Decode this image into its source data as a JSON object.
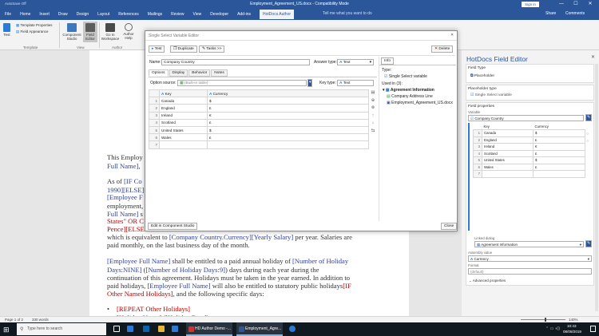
{
  "window": {
    "title": "Employment_Agreement_US.docx - Compatibility Mode",
    "autosave": "AutoSave  Off",
    "sign_in": "Sign in",
    "minimize": "—",
    "maximize": "☐",
    "close": "✕"
  },
  "ribbon": {
    "tabs": [
      "File",
      "Home",
      "Insert",
      "Draw",
      "Design",
      "Layout",
      "References",
      "Mailings",
      "Review",
      "View",
      "Developer",
      "Add-ins",
      "HotDocs Author"
    ],
    "active_tab": "HotDocs Author",
    "tell_me": "Tell me what you want to do",
    "share": "Share",
    "comments": "Comments",
    "test_label": "Test",
    "template_properties": "Template Properties",
    "field_appearance": "Field Appearance",
    "component_studio": "Component Studio",
    "field_editor": "Field Editor",
    "go_in_workspace": "Go In Workspace",
    "author_help": "Author Help",
    "group_template": "Template",
    "group_view": "View",
    "group_author": "Author"
  },
  "document": {
    "lines": [
      {
        "parts": [
          [
            "This Employ",
            "t"
          ]
        ]
      },
      {
        "parts": [
          [
            "Full Name]",
            "b"
          ],
          [
            ", ",
            "t"
          ]
        ]
      },
      {
        "parts": [
          [
            "As of ",
            "t"
          ],
          [
            "[IF Co",
            "b"
          ]
        ]
      },
      {
        "parts": [
          [
            "1990][ELSE]",
            "b"
          ]
        ]
      },
      {
        "parts": [
          [
            "[Employee F",
            "b"
          ]
        ]
      },
      {
        "parts": [
          [
            "employment,",
            "t"
          ]
        ]
      },
      {
        "parts": [
          [
            "Full Name]",
            "b"
          ],
          [
            " s",
            "t"
          ]
        ]
      },
      {
        "parts": [
          [
            "States\" OR C",
            "r"
          ]
        ]
      },
      {
        "parts": [
          [
            "Pence][ELSE",
            "r"
          ]
        ]
      },
      {
        "parts": [
          [
            "which is equivalent to ",
            "t"
          ],
          [
            "[Company Country.Currency][Yearly Salary]",
            "b"
          ],
          [
            " per year. Salaries are",
            "t"
          ]
        ]
      },
      {
        "parts": [
          [
            "paid monthly, on the last business day of the month.",
            "t"
          ]
        ]
      },
      {
        "parts": [
          [
            "[Employee Full Name]",
            "b"
          ],
          [
            " shall be entitled to a paid annual holiday of ",
            "t"
          ],
          [
            "[Number of Holiday",
            "b"
          ]
        ]
      },
      {
        "parts": [
          [
            "Days:NINE]",
            "b"
          ],
          [
            " (",
            "t"
          ],
          [
            "[Number of Holiday Days:9]",
            "b"
          ],
          [
            ") days during each year during the",
            "t"
          ]
        ]
      },
      {
        "parts": [
          [
            "continuation of this agreement. Holidays must be taken in the year earned. In addition to",
            "t"
          ]
        ]
      },
      {
        "parts": [
          [
            "paid holidays, ",
            "t"
          ],
          [
            "[Employee Full Name]",
            "b"
          ],
          [
            " will also be entitled to statutory public holidays",
            "t"
          ],
          [
            "[IF",
            "r"
          ]
        ]
      },
      {
        "parts": [
          [
            "Other Named Holidays]",
            "r"
          ],
          [
            ", and the following specific days:",
            "t"
          ]
        ]
      },
      {
        "parts": [
          [
            "[REPEAT Other Holidays]",
            "r"
          ]
        ]
      },
      {
        "parts": [
          [
            "[Holiday Name]",
            "b"
          ],
          [
            " (",
            "t"
          ],
          [
            "[Holiday Date]",
            "b"
          ],
          [
            ")",
            "t"
          ]
        ]
      }
    ],
    "bullet": "•"
  },
  "status": {
    "page": "Page 1 of 2",
    "words": "330 words",
    "zoom": "140%"
  },
  "taskbar": {
    "search": "Type here to search",
    "app1": "HD Author Demo -...",
    "app2": "Employment_Agre...",
    "time": "10:43",
    "date": "08/08/2019"
  },
  "dialog": {
    "title": "Single Select Variable Editor",
    "toolbar": {
      "test": "Test",
      "duplicate": "Duplicate",
      "tasks": "Tasks >>",
      "delete": "Delete"
    },
    "name_label": "Name:",
    "name_value": "Company Country",
    "answer_type_label": "Answer type:",
    "answer_type_value": "Text",
    "tabs": [
      "Options",
      "Display",
      "Behavior",
      "Notes"
    ],
    "options_from_label": "Option source:",
    "options_from_value": "(Built-in table)",
    "key_type_label": "Key type:",
    "key_type_value": "Text",
    "columns": [
      "Key",
      "Currency"
    ],
    "rows": [
      {
        "num": "1",
        "key": "Canada",
        "val": "$"
      },
      {
        "num": "2",
        "key": "England",
        "val": "£"
      },
      {
        "num": "3",
        "key": "Ireland",
        "val": "€"
      },
      {
        "num": "4",
        "key": "Scotland",
        "val": "£"
      },
      {
        "num": "5",
        "key": "United States",
        "val": "$"
      },
      {
        "num": "6",
        "key": "Wales",
        "val": "£"
      },
      {
        "num": "7",
        "key": "",
        "val": ""
      }
    ],
    "info_tab": "Info",
    "type_label": "Type:",
    "type_value": "Single Select variable",
    "used_in_label": "Used in (3):",
    "used_in": [
      "Agreement Information",
      "Company Address Line",
      "Employment_Agreement_US.docx"
    ],
    "edit_in_studio": "Edit in Component Studio",
    "close": "Close"
  },
  "panel": {
    "title": "HotDocs Field Editor",
    "field_type_label": "Field Type",
    "field_type_value": "Placeholder",
    "placeholder_type_label": "Placeholder type",
    "placeholder_type_value": "Single Select variable",
    "field_properties_label": "Field properties",
    "variable_label": "Variable",
    "variable_value": "Company Country",
    "columns": [
      "Key",
      "Currency"
    ],
    "rows": [
      {
        "num": "1",
        "key": "Canada",
        "val": "$"
      },
      {
        "num": "2",
        "key": "England",
        "val": "£"
      },
      {
        "num": "3",
        "key": "Ireland",
        "val": "€"
      },
      {
        "num": "4",
        "key": "Scotland",
        "val": "£"
      },
      {
        "num": "5",
        "key": "United States",
        "val": "$"
      },
      {
        "num": "6",
        "key": "Wales",
        "val": "£"
      },
      {
        "num": "7",
        "key": "",
        "val": ""
      }
    ],
    "linked_dialog_label": "Linked dialog",
    "linked_dialog_value": "Agreement Information",
    "assembly_value_label": "Assembly value",
    "assembly_value": "Currency",
    "format_label": "Format",
    "format_value": "(default)",
    "advanced": "Advanced properties"
  },
  "colors": {
    "word_blue": "#2b579a",
    "field_blue": "#2f3f9e",
    "field_red": "#c00000"
  }
}
